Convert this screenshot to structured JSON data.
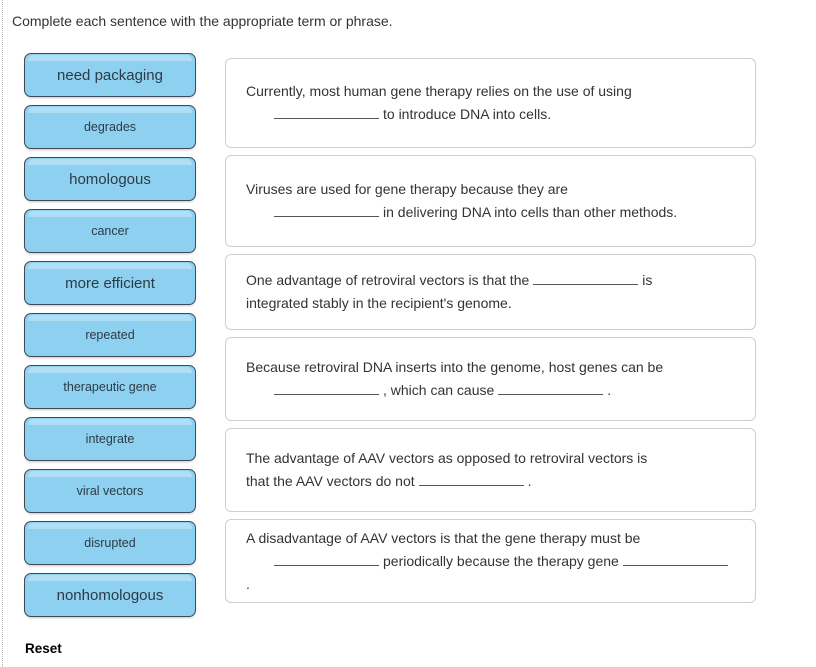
{
  "prompt": "Complete each sentence with the appropriate term or phrase.",
  "reset_label": "Reset",
  "word_bank": {
    "tiles": [
      {
        "label": "need packaging",
        "size": "lg"
      },
      {
        "label": "degrades",
        "size": "sm"
      },
      {
        "label": "homologous",
        "size": "lg"
      },
      {
        "label": "cancer",
        "size": "sm"
      },
      {
        "label": "more efficient",
        "size": "lg"
      },
      {
        "label": "repeated",
        "size": "sm"
      },
      {
        "label": "therapeutic gene",
        "size": "sm"
      },
      {
        "label": "integrate",
        "size": "sm"
      },
      {
        "label": "viral vectors",
        "size": "sm"
      },
      {
        "label": "disrupted",
        "size": "sm"
      },
      {
        "label": "nonhomologous",
        "size": "lg"
      }
    ]
  },
  "sentences": [
    {
      "height": "h90",
      "p1": "Currently, most human gene therapy relies on the use of using",
      "p2": "to introduce DNA into cells.",
      "p3": "",
      "blanks": 1
    },
    {
      "height": "h92",
      "p1": "Viruses are used for gene therapy because they are",
      "p2": "in delivering DNA into cells than other methods.",
      "p3": "",
      "blanks": 1
    },
    {
      "height": "h76",
      "p1": "One advantage of retroviral vectors is that the",
      "p2": "is",
      "p3": "integrated stably in the recipient's genome.",
      "blanks": 1
    },
    {
      "height": "h84",
      "p1": "Because retroviral DNA inserts into the genome, host genes can be",
      "p2": ", which can cause",
      "p3": ".",
      "blanks": 2
    },
    {
      "height": "h84",
      "p1": "The advantage of AAV vectors as opposed to retroviral vectors is",
      "p2": "that the AAV vectors do not",
      "p3": ".",
      "blanks": 1
    },
    {
      "height": "h84",
      "p1": "A disadvantage of AAV vectors is that the gene therapy must be",
      "p2": "periodically because the therapy gene",
      "p3": ".",
      "blanks": 2
    }
  ]
}
